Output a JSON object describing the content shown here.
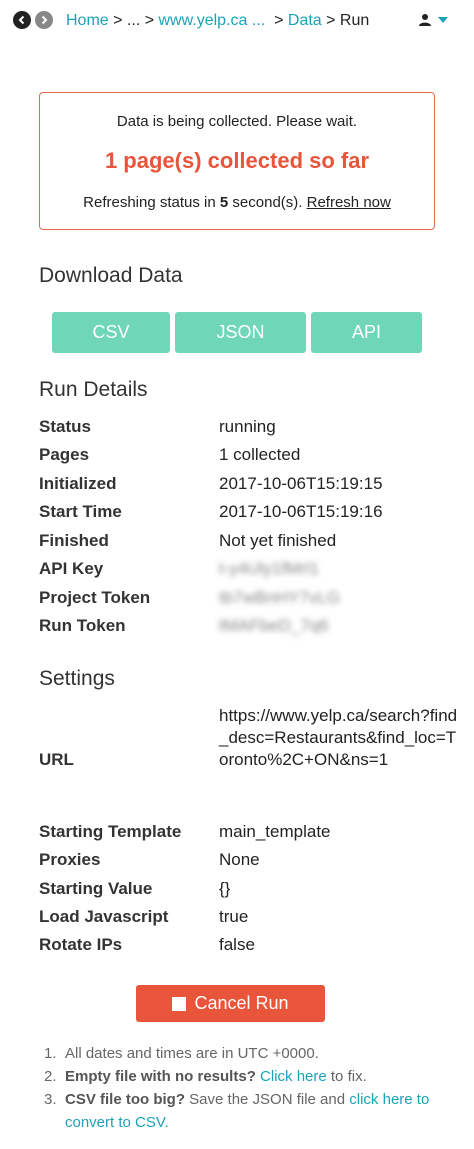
{
  "nav": {
    "back_icon": "chevron-left-icon",
    "forward_icon": "chevron-right-icon",
    "breadcrumb": {
      "home": "Home",
      "sep1": " > ",
      "ellipsis": "...",
      "sep2": " > ",
      "site": "www.yelp.ca ...",
      "sep3": " > ",
      "data": "Data",
      "sep4": " > ",
      "current": "Run"
    },
    "user_icon": "user-icon"
  },
  "status": {
    "message": "Data is being collected. Please wait.",
    "collected": "1 page(s) collected so far",
    "refresh_prefix": "Refreshing status in ",
    "refresh_seconds": "5",
    "refresh_suffix": " second(s). ",
    "refresh_now": "Refresh now"
  },
  "download": {
    "heading": "Download Data",
    "csv": "CSV",
    "json": "JSON",
    "api": "API"
  },
  "run_details": {
    "heading": "Run Details",
    "rows": [
      {
        "label": "Status",
        "value": "running"
      },
      {
        "label": "Pages",
        "value": "1 collected"
      },
      {
        "label": "Initialized",
        "value": "2017-10-06T15:19:15"
      },
      {
        "label": "Start Time",
        "value": "2017-10-06T15:19:16"
      },
      {
        "label": "Finished",
        "value": "Not yet finished"
      },
      {
        "label": "API Key",
        "value": "t-y4Uly1fMrl1"
      },
      {
        "label": "Project Token",
        "value": "tb7wBnHY7vLG"
      },
      {
        "label": "Run Token",
        "value": "tMAFbeD_7q6"
      }
    ]
  },
  "settings": {
    "heading": "Settings",
    "url_label": "URL",
    "url_value": "https://www.yelp.ca/search?find_desc=Restaurants&find_loc=Toronto%2C+ON&ns=1",
    "rows": [
      {
        "label": "Starting Template",
        "value": "main_template"
      },
      {
        "label": "Proxies",
        "value": "None"
      },
      {
        "label": "Starting Value",
        "value": "{}"
      },
      {
        "label": "Load Javascript",
        "value": "true"
      },
      {
        "label": "Rotate IPs",
        "value": "false"
      }
    ]
  },
  "cancel": {
    "label": "Cancel Run"
  },
  "notes": {
    "n1": "1.",
    "n2": "2.",
    "n3": "3.",
    "note1": "All dates and times are in UTC +0000.",
    "note2_bold": "Empty file with no results?",
    "note2_link": "Click here",
    "note2_rest": " to fix.",
    "note3_bold": "CSV file too big?",
    "note3_rest": " Save the JSON file and ",
    "note3_link": "click here to convert to CSV."
  },
  "colors": {
    "accent": "#1aa3b7",
    "button_green": "#6fd6b8",
    "cancel_red": "#e8553a"
  }
}
